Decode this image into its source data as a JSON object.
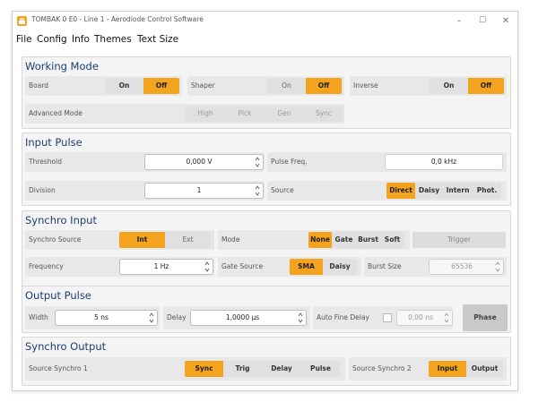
{
  "window": {
    "title": "TOMBAK 0 E0 - Line 1 - Aerodiode Control Software",
    "minimize": "–",
    "maximize": "☐",
    "close": "✕",
    "icon": "app-logo-icon",
    "accent_color": "#f3a31d",
    "heading_color": "#1c3e73"
  },
  "menu": {
    "file": "File",
    "config": "Config",
    "info": "Info",
    "themes": "Themes",
    "text_size": "Text Size"
  },
  "working_mode": {
    "title": "Working Mode",
    "board": {
      "label": "Board",
      "on": "On",
      "off": "Off",
      "selected": "Off"
    },
    "shaper": {
      "label": "Shaper",
      "on": "On",
      "off": "Off",
      "selected": "Off"
    },
    "inverse": {
      "label": "Inverse",
      "on": "On",
      "off": "Off",
      "selected": "Off"
    },
    "advanced": {
      "label": "Advanced Mode",
      "options": [
        "High",
        "Pick",
        "Gen",
        "Sync"
      ]
    }
  },
  "input_pulse": {
    "title": "Input Pulse",
    "threshold": {
      "label": "Threshold",
      "value": "0,000 V"
    },
    "pulse_freq": {
      "label": "Pulse Freq.",
      "value": "0,0 kHz"
    },
    "division": {
      "label": "Division",
      "value": "1"
    },
    "source": {
      "label": "Source",
      "options": [
        "Direct",
        "Daisy",
        "Intern",
        "Phot."
      ],
      "selected": "Direct"
    }
  },
  "synchro_input": {
    "title": "Synchro Input",
    "synchro_source": {
      "label": "Synchro Source",
      "options": [
        "Int",
        "Ext"
      ],
      "selected": "Int"
    },
    "mode": {
      "label": "Mode",
      "options": [
        "None",
        "Gate",
        "Burst",
        "Soft"
      ],
      "selected": "None"
    },
    "trigger": "Trigger",
    "frequency": {
      "label": "Frequency",
      "value": "1 Hz"
    },
    "gate_source": {
      "label": "Gate Source",
      "options": [
        "SMA",
        "Daisy"
      ],
      "selected": "SMA"
    },
    "burst_size": {
      "label": "Burst Size",
      "value": "65536"
    }
  },
  "output_pulse": {
    "title": "Output Pulse",
    "width": {
      "label": "Width",
      "value": "5 ns"
    },
    "delay": {
      "label": "Delay",
      "value": "1,0000 µs"
    },
    "auto_fine_delay": {
      "label": "Auto Fine Delay",
      "value": "0,00 ns"
    },
    "phase": "Phase"
  },
  "synchro_output": {
    "title": "Synchro Output",
    "source1": {
      "label": "Source Synchro 1",
      "options": [
        "Sync",
        "Trig",
        "Delay",
        "Pulse"
      ],
      "selected": "Sync"
    },
    "source2": {
      "label": "Source Synchro 2",
      "options": [
        "Input",
        "Output"
      ],
      "selected": "Input"
    }
  }
}
